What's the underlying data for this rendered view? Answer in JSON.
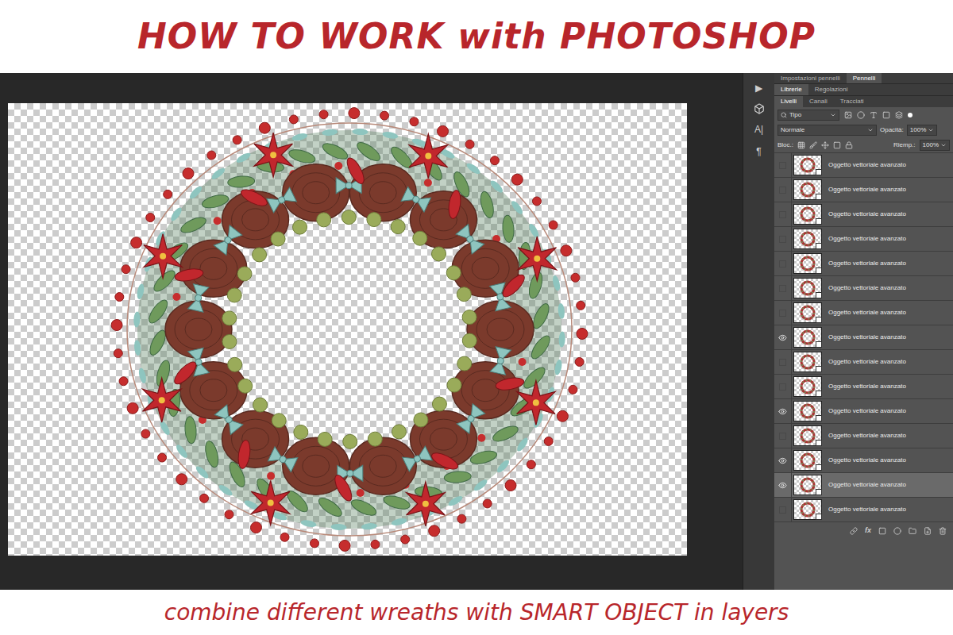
{
  "header": {
    "title": "HOW TO WORK with PHOTOSHOP"
  },
  "footer": {
    "caption": "combine different wreaths with SMART OBJECT in layers"
  },
  "side_tools": [
    "▶",
    "A|",
    "¶"
  ],
  "panel": {
    "top_tabs": [
      {
        "label": "Impostazioni pennelli",
        "selected": false
      },
      {
        "label": "Pennelli",
        "selected": true
      }
    ],
    "tabs_row1": [
      {
        "label": "Librerie",
        "selected": true
      },
      {
        "label": "Regolazioni",
        "selected": false
      }
    ],
    "tabs_row2": [
      {
        "label": "Livelli",
        "selected": true
      },
      {
        "label": "Canali",
        "selected": false
      },
      {
        "label": "Tracciati",
        "selected": false
      }
    ],
    "filter": {
      "value": "Tipo"
    },
    "blend_mode": {
      "value": "Normale"
    },
    "opacity": {
      "label": "Opacità:",
      "value": "100%"
    },
    "lock": {
      "label": "Bloc.:"
    },
    "fill": {
      "label": "Riemp.:",
      "value": "100%"
    },
    "fx_button": "fx"
  },
  "layers": [
    {
      "name": "Oggetto vettoriale avanzato",
      "visible": false,
      "selected": false
    },
    {
      "name": "Oggetto vettoriale avanzato",
      "visible": false,
      "selected": false
    },
    {
      "name": "Oggetto vettoriale avanzato",
      "visible": false,
      "selected": false
    },
    {
      "name": "Oggetto vettoriale avanzato",
      "visible": false,
      "selected": false
    },
    {
      "name": "Oggetto vettoriale avanzato",
      "visible": false,
      "selected": false
    },
    {
      "name": "Oggetto vettoriale avanzato",
      "visible": false,
      "selected": false
    },
    {
      "name": "Oggetto vettoriale avanzato",
      "visible": false,
      "selected": false
    },
    {
      "name": "Oggetto vettoriale avanzato",
      "visible": true,
      "selected": false
    },
    {
      "name": "Oggetto vettoriale avanzato",
      "visible": false,
      "selected": false
    },
    {
      "name": "Oggetto vettoriale avanzato",
      "visible": false,
      "selected": false
    },
    {
      "name": "Oggetto vettoriale avanzato",
      "visible": true,
      "selected": false
    },
    {
      "name": "Oggetto vettoriale avanzato",
      "visible": false,
      "selected": false
    },
    {
      "name": "Oggetto vettoriale avanzato",
      "visible": true,
      "selected": false
    },
    {
      "name": "Oggetto vettoriale avanzato",
      "visible": true,
      "selected": true
    },
    {
      "name": "Oggetto vettoriale avanzato",
      "visible": false,
      "selected": false
    }
  ]
}
